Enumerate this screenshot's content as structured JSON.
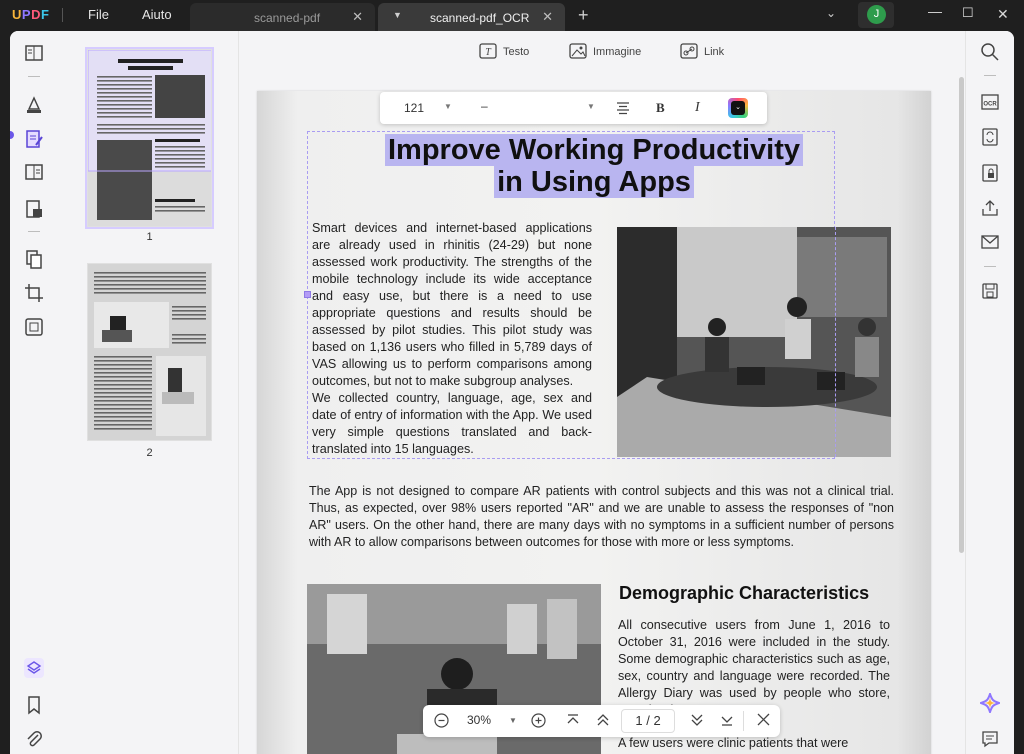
{
  "app": {
    "logo": "UPDF",
    "menu": [
      "File",
      "Aiuto"
    ]
  },
  "tabs": [
    {
      "label": "scanned-pdf",
      "active": false
    },
    {
      "label": "scanned-pdf_OCR",
      "active": true
    }
  ],
  "user": {
    "initial": "J",
    "color": "#2e9c4c"
  },
  "tools": {
    "text": "Testo",
    "image": "Immagine",
    "link": "Link"
  },
  "format_bar": {
    "font_size": "121",
    "font_family": "–"
  },
  "thumbnails": [
    {
      "page": "1"
    },
    {
      "page": "2"
    }
  ],
  "document": {
    "title_line1": "Improve Working Productivity",
    "title_line2": "in Using Apps",
    "paragraph1": "Smart devices and internet-based applications are already used in rhinitis (24-29) but none assessed work productivity. The strengths of the mobile technology include its wide acceptance and easy use, but there is a need to use appropriate questions and results should be assessed by pilot studies. This pilot study was based on 1,136 users who filled in 5,789 days of VAS allowing us to perform comparisons among outcomes, but not to make subgroup analyses.",
    "paragraph2": "We collected country, language, age, sex and date of entry of information with the App. We used very simple questions translated and back-translated into 15 languages.",
    "paragraph3": "The App is not designed to compare AR patients with control subjects and this was not a clinical trial. Thus, as expected, over 98% users reported \"AR\" and we are unable to assess the responses of \"non AR\" users. On the other hand, there are many days with no symptoms in a sufficient number of persons with AR to allow comparisons between outcomes for those with more or less symptoms.",
    "section_title": "Demographic Characteristics",
    "paragraph4": "All consecutive users from June 1, 2016 to October 31, 2016 were included in the study. Some demographic characteristics such as age, sex, country and language were recorded. The Allergy Diary was used by people who store, Google Play,",
    "paragraph5": "A few users were clinic patients that were"
  },
  "zoom": {
    "level": "30%",
    "page_current": "1",
    "page_sep": "/",
    "page_total": "2"
  }
}
